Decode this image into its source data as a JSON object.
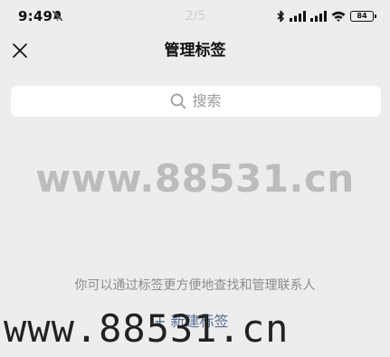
{
  "status_bar": {
    "time": "9:49",
    "page_indicator": "2/5",
    "battery": "84",
    "icons": [
      "mute-icon",
      "bluetooth-icon",
      "signal-icon",
      "signal-icon",
      "wifi-icon",
      "battery-icon"
    ]
  },
  "header": {
    "title": "管理标签",
    "close_icon": "close-icon"
  },
  "search": {
    "placeholder": "搜索",
    "icon": "search-icon"
  },
  "watermark": {
    "center": "www.88531.cn",
    "bottom": "www.88531.cn"
  },
  "content": {
    "hint": "你可以通过标签更方便地查找和管理联系人",
    "new_tag_label": "+ 新建标签"
  },
  "colors": {
    "background": "#ededed",
    "link": "#576b95",
    "hint": "#8c8c8c",
    "watermark": "#bcbcbc"
  }
}
